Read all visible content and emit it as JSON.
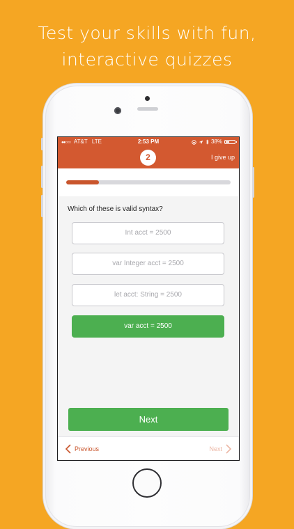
{
  "headline": {
    "line1": "Test your skills with fun,",
    "line2": "interactive quizzes"
  },
  "status_bar": {
    "signal": "●●○○○",
    "carrier": "AT&T",
    "network": "LTE",
    "time": "2:53 PM",
    "battery": "38%",
    "battery_level": 0.38
  },
  "header": {
    "question_number": "2",
    "give_up_label": "I give up",
    "accent_color": "#d35930"
  },
  "progress": {
    "fraction": 0.2
  },
  "quiz": {
    "question": "Which of these is valid syntax?",
    "answers": [
      {
        "label": "Int acct = 2500",
        "selected": false
      },
      {
        "label": "var Integer acct = 2500",
        "selected": false
      },
      {
        "label": "let acct: String = 2500",
        "selected": false
      },
      {
        "label": "var acct = 2500",
        "selected": true
      }
    ],
    "selected_color": "#4caf50"
  },
  "next_button": {
    "label": "Next"
  },
  "bottom_nav": {
    "previous_label": "Previous",
    "next_label": "Next"
  },
  "icons": {
    "previous": "chevron-left-icon",
    "next": "chevron-right-icon",
    "bluetooth": "bluetooth-icon",
    "location": "location-arrow-icon",
    "lock": "rotation-lock-icon",
    "battery": "battery-icon"
  }
}
